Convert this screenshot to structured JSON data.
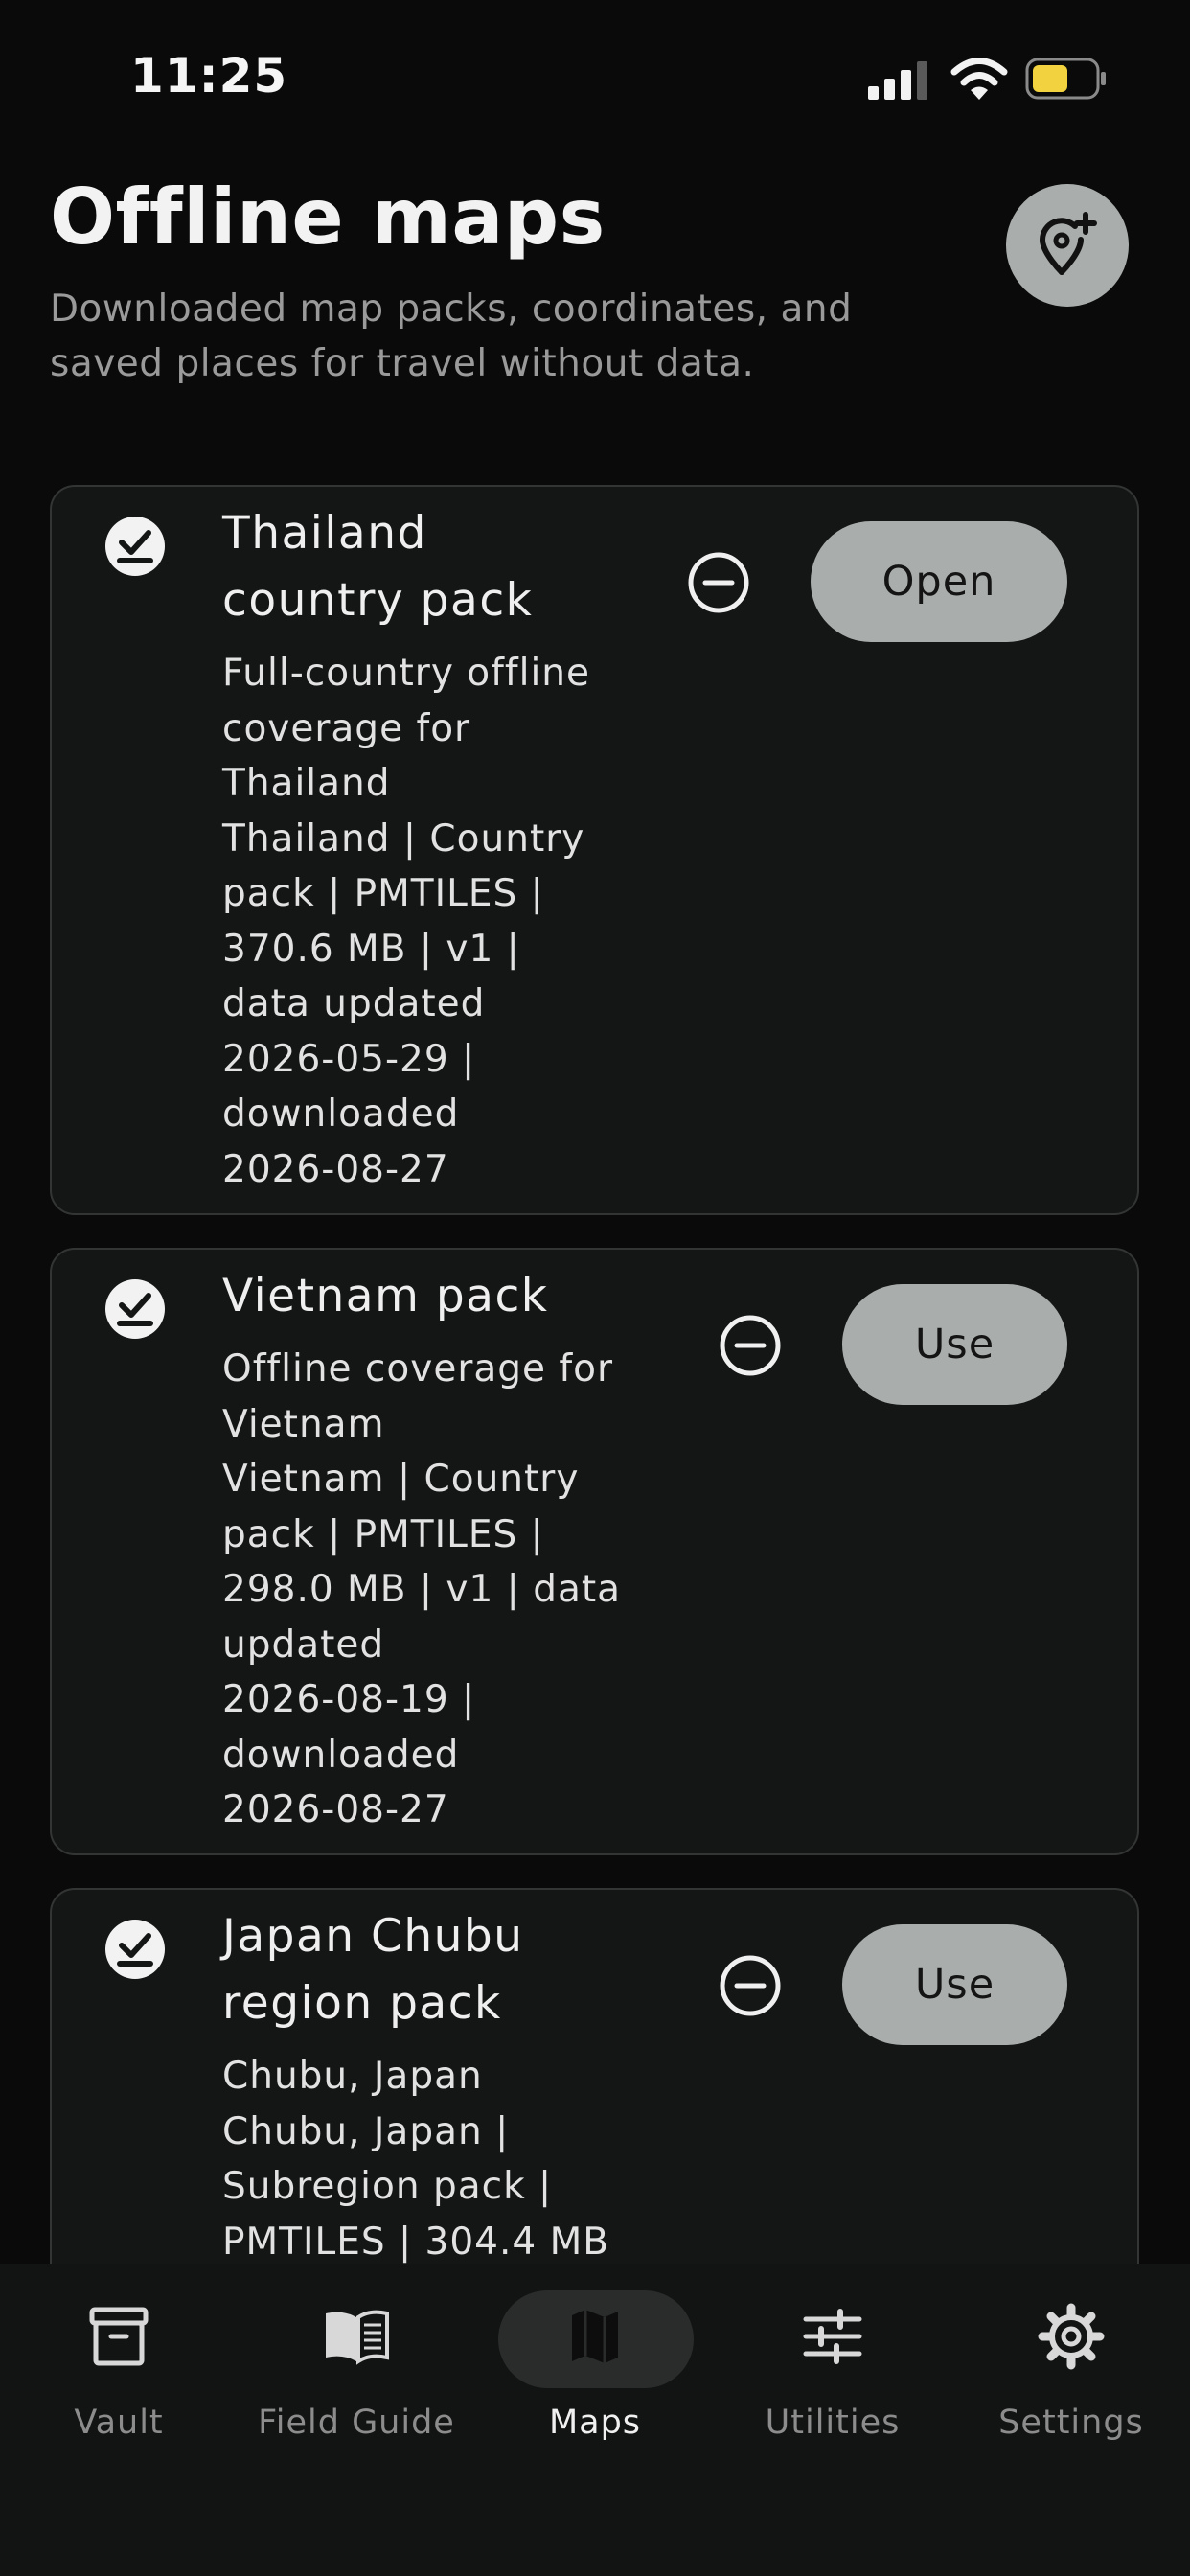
{
  "status_bar": {
    "time": "11:25"
  },
  "header": {
    "title": "Offline maps",
    "subtitle": "Downloaded map packs, coordinates, and saved places for travel without data."
  },
  "packs": [
    {
      "title_lines": [
        "Thailand",
        "country pack"
      ],
      "description": [
        "Full-country offline",
        "coverage for",
        "Thailand",
        "Thailand | Country",
        "pack | PMTILES |",
        "370.6 MB | v1 |",
        "data updated",
        "2026-05-29 |",
        "downloaded",
        "2026-08-27"
      ],
      "action_label": "Open"
    },
    {
      "title_lines": [
        "Vietnam pack"
      ],
      "description": [
        "Offline coverage for",
        "Vietnam",
        "Vietnam | Country",
        "pack | PMTILES |",
        "298.0 MB | v1 | data",
        "updated",
        "2026-08-19 |",
        "downloaded",
        "2026-08-27"
      ],
      "action_label": "Use"
    },
    {
      "title_lines": [
        "Japan Chubu",
        "region pack"
      ],
      "description": [
        "Chubu, Japan",
        "Chubu, Japan |",
        "Subregion pack |",
        "PMTILES | 304.4 MB"
      ],
      "action_label": "Use"
    }
  ],
  "nav": {
    "items": [
      {
        "label": "Vault",
        "icon": "archive-icon"
      },
      {
        "label": "Field Guide",
        "icon": "book-icon"
      },
      {
        "label": "Maps",
        "icon": "map-icon",
        "active": true
      },
      {
        "label": "Utilities",
        "icon": "sliders-icon"
      },
      {
        "label": "Settings",
        "icon": "gear-icon"
      }
    ]
  },
  "colors": {
    "background": "#0a0a0a",
    "card": "#141515",
    "button": "#a9aeac",
    "battery": "#f2d33f"
  }
}
